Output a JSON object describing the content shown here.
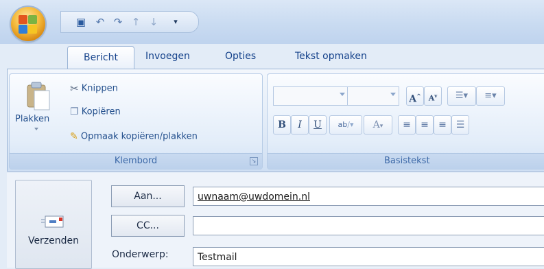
{
  "ribbon": {
    "tabs": [
      "Bericht",
      "Invoegen",
      "Opties",
      "Tekst opmaken"
    ],
    "clipboard": {
      "paste_label": "Plakken",
      "cut_label": "Knippen",
      "copy_label": "Kopiëren",
      "format_painter_label": "Opmaak kopiëren/plakken",
      "group_label": "Klembord"
    },
    "basic_text": {
      "group_label": "Basistekst",
      "bold": "B",
      "italic": "I",
      "underline": "U",
      "highlight": "ab",
      "font_color": "A",
      "grow_font": "A",
      "shrink_font": "A"
    }
  },
  "compose": {
    "send_label": "Verzenden",
    "to_button": "Aan...",
    "cc_button": "CC...",
    "subject_label": "Onderwerp:",
    "to_value": "uwnaam@uwdomein.nl",
    "cc_value": "",
    "subject_value": "Testmail"
  },
  "colors": {
    "accent": "#15428b",
    "ribbon_bg": "#dde8f6",
    "orb": "#f4b93a"
  },
  "icons": [
    "office-orb-icon",
    "save-icon",
    "undo-icon",
    "redo-icon",
    "up-arrow-icon",
    "down-arrow-icon",
    "qat-dropdown-icon",
    "paste-icon",
    "scissors-icon",
    "copy-icon",
    "format-painter-icon",
    "dialog-launcher-icon",
    "bullets-icon",
    "numbering-icon",
    "align-left-icon",
    "center-icon",
    "align-right-icon",
    "justify-icon",
    "envelope-icon"
  ]
}
